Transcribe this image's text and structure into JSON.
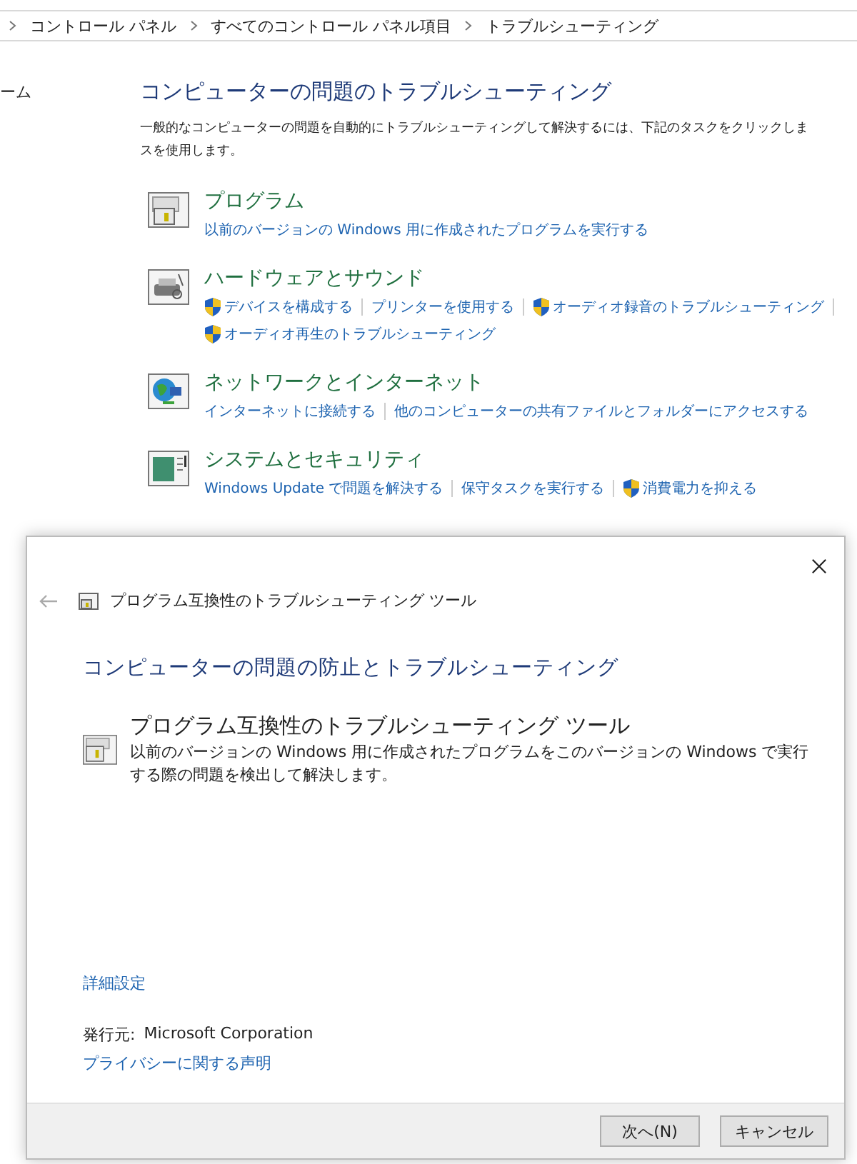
{
  "address_bar": {
    "breadcrumbs": [
      "コントロール パネル",
      "すべてのコントロール パネル項目",
      "トラブルシューティング"
    ]
  },
  "sidebar": {
    "items": [
      "ーム"
    ]
  },
  "main": {
    "title": "コンピューターの問題のトラブルシューティング",
    "description": [
      "一般的なコンピューターの問題を自動的にトラブルシューティングして解決するには、下記のタスクをクリックしま",
      "スを使用します。"
    ]
  },
  "categories": [
    {
      "kind": "program",
      "title": "プログラム",
      "links": [
        {
          "text": "以前のバージョンの Windows 用に作成されたプログラムを実行する",
          "shield": false
        }
      ]
    },
    {
      "kind": "hardware",
      "title": "ハードウェアとサウンド",
      "links": [
        {
          "text": "デバイスを構成する",
          "shield": true
        },
        {
          "text": "プリンターを使用する",
          "shield": false
        },
        {
          "text": "オーディオ録音のトラブルシューティング",
          "shield": true
        },
        {
          "text": "オーディオ再生のトラブルシューティング",
          "shield": true
        }
      ]
    },
    {
      "kind": "network",
      "title": "ネットワークとインターネット",
      "links": [
        {
          "text": "インターネットに接続する",
          "shield": false
        },
        {
          "text": "他のコンピューターの共有ファイルとフォルダーにアクセスする",
          "shield": false
        }
      ]
    },
    {
      "kind": "system",
      "title": "システムとセキュリティ",
      "links": [
        {
          "text": "Windows Update で問題を解決する",
          "shield": false
        },
        {
          "text": "保守タスクを実行する",
          "shield": false
        },
        {
          "text": "消費電力を抑える",
          "shield": true
        }
      ]
    }
  ],
  "dialog": {
    "title": "プログラム互換性のトラブルシューティング ツール",
    "back_enabled": false,
    "heading": "コンピューターの問題の防止とトラブルシューティング",
    "item": {
      "title": "プログラム互換性のトラブルシューティング ツール",
      "description": "以前のバージョンの Windows 用に作成されたプログラムをこのバージョンの Windows で実行する際の問題を検出して解決します。"
    },
    "advanced_link": "詳細設定",
    "publisher_label": "発行元:",
    "publisher": "Microsoft Corporation",
    "privacy_link": "プライバシーに関する声明",
    "buttons": [
      "次へ(N)",
      "キャンセル"
    ]
  }
}
